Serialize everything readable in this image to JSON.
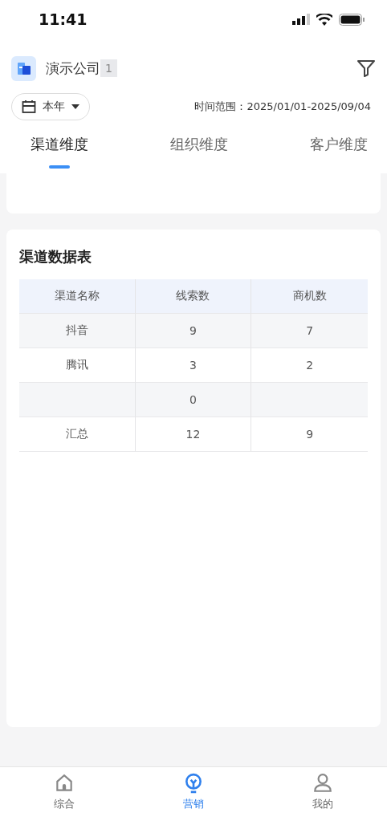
{
  "status_bar": {
    "time": "11:41"
  },
  "header": {
    "company": "演示公司",
    "badge": "1"
  },
  "filter": {
    "period": "本年",
    "range": "时间范围：2025/01/01-2025/09/04"
  },
  "tabs": [
    {
      "label": "渠道维度",
      "selected": true
    },
    {
      "label": "组织维度",
      "selected": false
    },
    {
      "label": "客户维度",
      "selected": false
    }
  ],
  "table": {
    "title": "渠道数据表",
    "columns": [
      "渠道名称",
      "线索数",
      "商机数"
    ],
    "rows": [
      [
        "抖音",
        "9",
        "7"
      ],
      [
        "腾讯",
        "3",
        "2"
      ],
      [
        "",
        "0",
        ""
      ],
      [
        "汇总",
        "12",
        "9"
      ]
    ]
  },
  "bottom_nav": [
    {
      "label": "综合",
      "kind": "home",
      "selected": false
    },
    {
      "label": "营销",
      "kind": "bulb",
      "selected": true
    },
    {
      "label": "我的",
      "kind": "person",
      "selected": false
    }
  ]
}
